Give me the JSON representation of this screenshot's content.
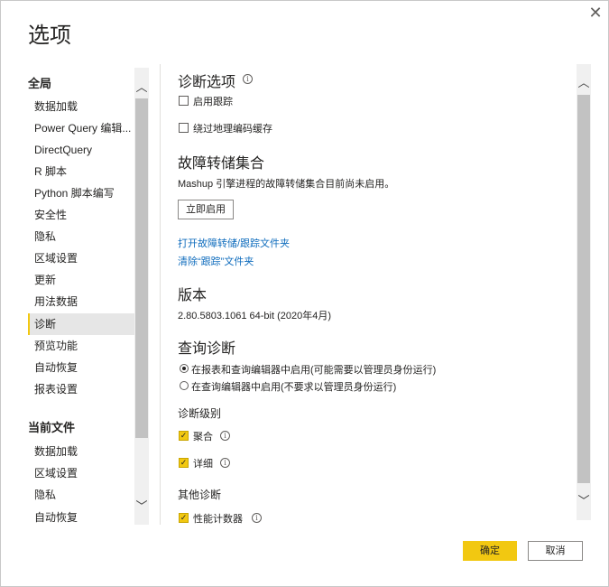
{
  "dialog": {
    "title": "选项",
    "close_glyph": "✕"
  },
  "nav": {
    "global_header": "全局",
    "global_items": [
      {
        "label": "数据加载"
      },
      {
        "label": "Power Query 编辑..."
      },
      {
        "label": "DirectQuery"
      },
      {
        "label": "R 脚本"
      },
      {
        "label": "Python 脚本编写"
      },
      {
        "label": "安全性"
      },
      {
        "label": "隐私"
      },
      {
        "label": "区域设置"
      },
      {
        "label": "更新"
      },
      {
        "label": "用法数据"
      },
      {
        "label": "诊断"
      },
      {
        "label": "预览功能"
      },
      {
        "label": "自动恢复"
      },
      {
        "label": "报表设置"
      }
    ],
    "selected_item": "诊断",
    "file_header": "当前文件",
    "file_items": [
      {
        "label": "数据加载"
      },
      {
        "label": "区域设置"
      },
      {
        "label": "隐私"
      },
      {
        "label": "自动恢复"
      }
    ],
    "scroll_up_glyph": "︿",
    "scroll_down_glyph": "﹀"
  },
  "main": {
    "diag_options": {
      "title": "诊断选项",
      "info_glyph": "i",
      "enable_trace": {
        "label": "启用跟踪",
        "checked": false
      },
      "bypass_geocode": {
        "label": "绕过地理编码缓存",
        "checked": false
      }
    },
    "crash_dump": {
      "title": "故障转储集合",
      "description": "Mashup 引擎进程的故障转储集合目前尚未启用。",
      "enable_now_button": "立即启用",
      "open_folder_link": "打开故障转储/跟踪文件夹",
      "clear_trace_link": "清除“跟踪”文件夹"
    },
    "version": {
      "title": "版本",
      "value": "2.80.5803.1061 64-bit (2020年4月)"
    },
    "query_diag": {
      "title": "查询诊断",
      "options": [
        {
          "label": "在报表和查询编辑器中启用(可能需要以管理员身份运行)",
          "checked": true
        },
        {
          "label": "在查询编辑器中启用(不要求以管理员身份运行)",
          "checked": false
        }
      ]
    },
    "diag_level": {
      "title": "诊断级别",
      "aggregate": {
        "label": "聚合",
        "checked": true
      },
      "detailed": {
        "label": "详细",
        "checked": true
      }
    },
    "other_diag": {
      "title": "其他诊断",
      "perf_counters": {
        "label": "性能计数器",
        "checked": true
      }
    },
    "check_glyph": "✓"
  },
  "footer": {
    "ok_button": "确定",
    "cancel_button": "取消"
  },
  "colors": {
    "accent": "#f2c811",
    "link": "#0f6cbd",
    "text": "#252423",
    "selected_bg": "#e6e6e6"
  }
}
